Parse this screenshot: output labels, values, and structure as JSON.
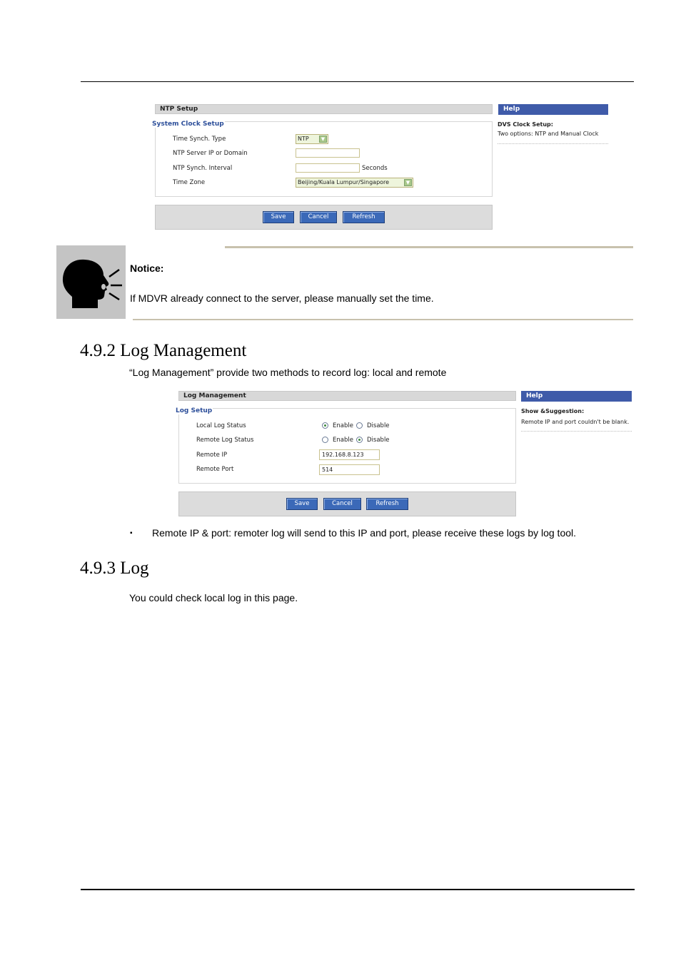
{
  "ntp_screen": {
    "title": "NTP Setup",
    "section": "System Clock Setup",
    "fields": [
      {
        "label": "Time Synch. Type",
        "value": "NTP"
      },
      {
        "label": "NTP Server IP or Domain",
        "value": ""
      },
      {
        "label": "NTP Synch. Interval",
        "value": "",
        "unit": "Seconds"
      },
      {
        "label": "Time Zone",
        "value": "Beijing/Kuala Lumpur/Singapore"
      }
    ],
    "buttons": {
      "save": "Save",
      "cancel": "Cancel",
      "refresh": "Refresh"
    },
    "help": {
      "title": "Help",
      "heading": "DVS Clock Setup:",
      "text": "Two options: NTP and Manual Clock"
    }
  },
  "notice": {
    "title": "Notice:",
    "text": "If MDVR already connect to the server, please manually set the time."
  },
  "section_log_management": {
    "heading": "4.9.2 Log Management",
    "intro": "“Log Management” provide two methods to record log: local and remote"
  },
  "log_screen": {
    "title": "Log Management",
    "section": "Log Setup",
    "local_log_status": {
      "label": "Local Log Status",
      "options": [
        "Enable",
        "Disable"
      ],
      "selected": "Enable"
    },
    "remote_log_status": {
      "label": "Remote Log Status",
      "options": [
        "Enable",
        "Disable"
      ],
      "selected": "Disable"
    },
    "remote_ip": {
      "label": "Remote IP",
      "value": "192.168.8.123"
    },
    "remote_port": {
      "label": "Remote Port",
      "value": "514"
    },
    "buttons": {
      "save": "Save",
      "cancel": "Cancel",
      "refresh": "Refresh"
    },
    "help": {
      "title": "Help",
      "heading": "Show &Suggestion:",
      "text": "Remote IP and port couldn't be blank."
    }
  },
  "bullet": {
    "marker": "▪",
    "text": "Remote IP & port: remoter log will send to this IP and port, please receive these logs by log tool."
  },
  "section_log": {
    "heading": "4.9.3 Log",
    "intro": "You could check local log in this page."
  },
  "colors": {
    "help_bar": "#3f5ba9",
    "button": "#3b69b8",
    "section_label": "#2d4f9a",
    "notice_rule": "#c8c1ad"
  }
}
